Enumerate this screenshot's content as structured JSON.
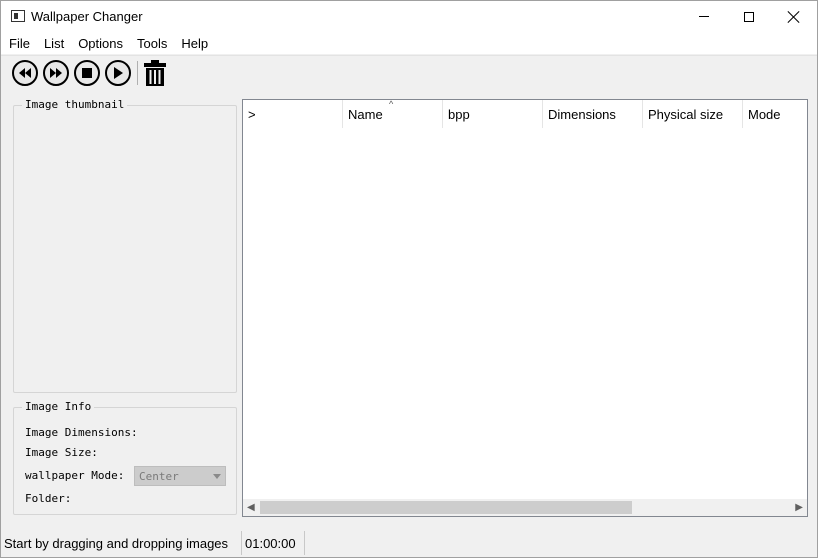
{
  "window": {
    "title": "Wallpaper Changer"
  },
  "menu": {
    "items": [
      "File",
      "List",
      "Options",
      "Tools",
      "Help"
    ]
  },
  "toolbar": {
    "buttons": [
      "previous-icon",
      "next-icon",
      "stop-icon",
      "play-icon",
      "trash-icon"
    ]
  },
  "left_panel": {
    "thumbnail_title": "Image thumbnail",
    "info_title": "Image Info",
    "dimensions_label": "Image Dimensions:",
    "size_label": "Image Size:",
    "mode_label": "wallpaper Mode:",
    "mode_value": "Center",
    "folder_label": "Folder:"
  },
  "list": {
    "columns": [
      ">",
      "Name",
      "bpp",
      "Dimensions",
      "Physical size",
      "Mode"
    ],
    "sort_indicator": "^"
  },
  "status": {
    "message": "Start by dragging and dropping images",
    "time": "01:00:00"
  }
}
